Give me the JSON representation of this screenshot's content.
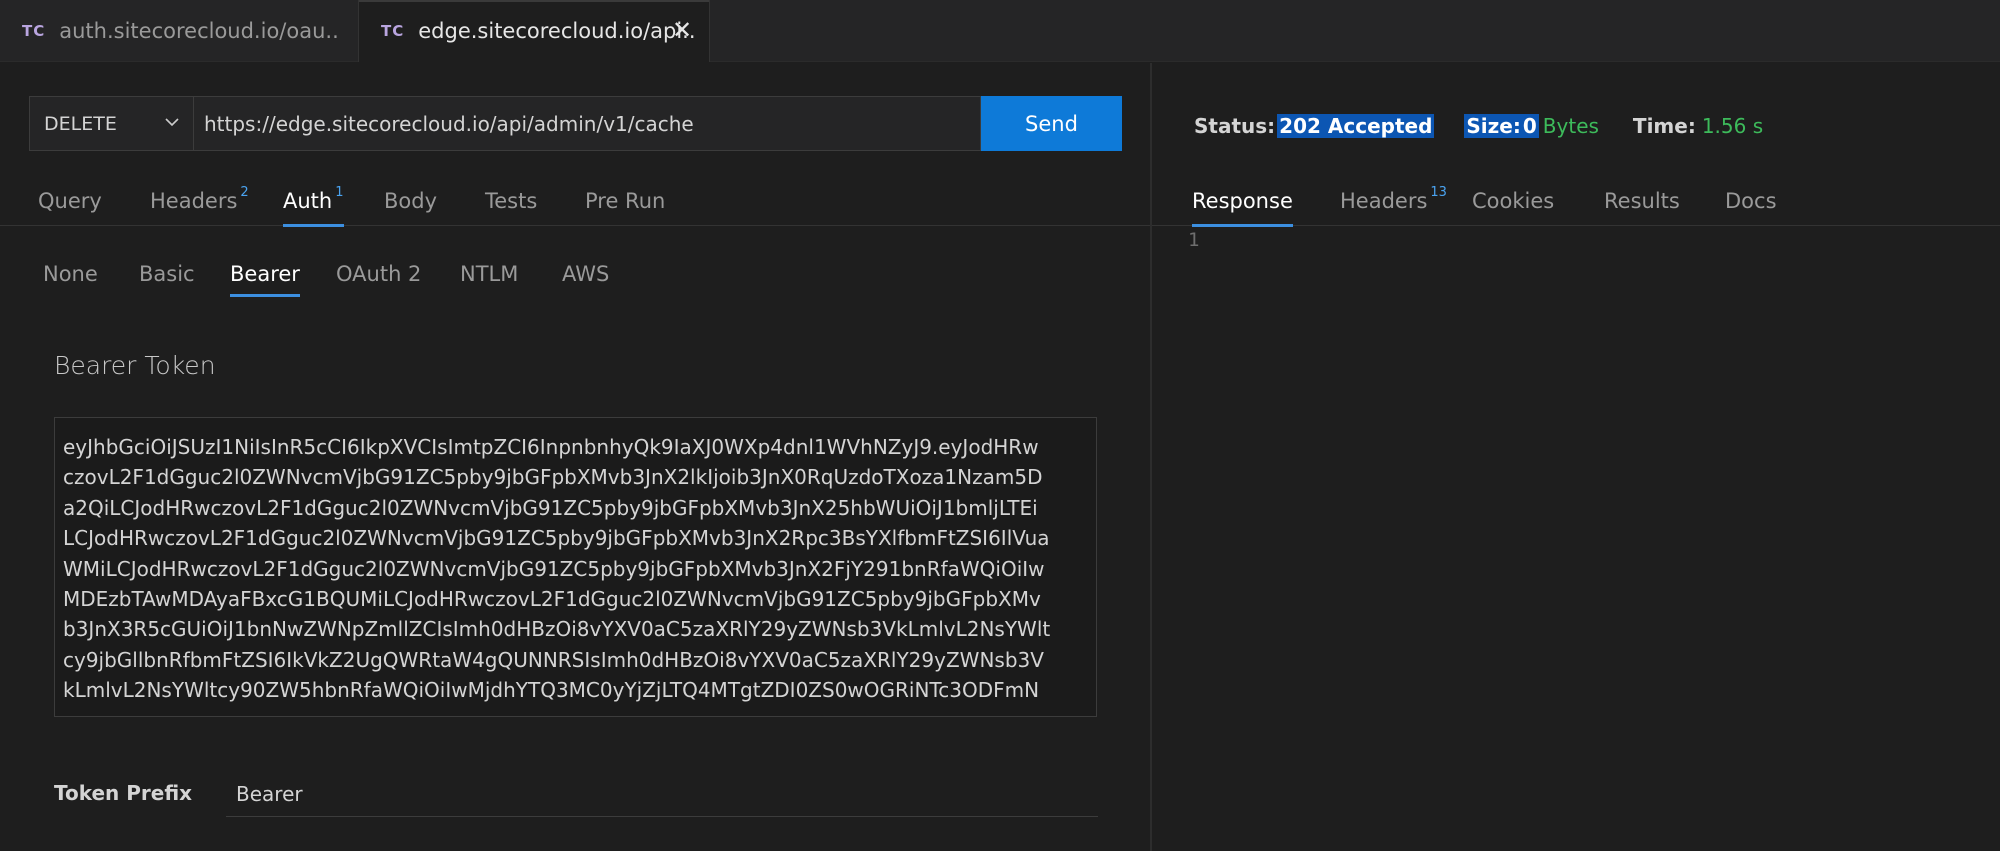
{
  "tabs": [
    {
      "icon": "TC",
      "label": "auth.sitecorecloud.io/oau.."
    },
    {
      "icon": "TC",
      "label": "edge.sitecorecloud.io/api..",
      "close": "✕"
    }
  ],
  "request": {
    "method": "DELETE",
    "url": "https://edge.sitecorecloud.io/api/admin/v1/cache",
    "send_label": "Send",
    "tabs": [
      {
        "label": "Query"
      },
      {
        "label": "Headers",
        "badge": "2"
      },
      {
        "label": "Auth",
        "badge": "1"
      },
      {
        "label": "Body"
      },
      {
        "label": "Tests"
      },
      {
        "label": "Pre Run"
      }
    ]
  },
  "auth": {
    "tabs": [
      "None",
      "Basic",
      "Bearer",
      "OAuth 2",
      "NTLM",
      "AWS"
    ],
    "bearer_label": "Bearer Token",
    "token_lines": [
      "eyJhbGciOiJSUzI1NiIsInR5cCI6IkpXVCIsImtpZCI6InpnbnhyQk9IaXJ0WXp4dnl1WVhNZyJ9.eyJodHRw",
      "czovL2F1dGguc2l0ZWNvcmVjbG91ZC5pby9jbGFpbXMvb3JnX2lkIjoib3JnX0RqUzdoTXoza1Nzam5D",
      "a2QiLCJodHRwczovL2F1dGguc2l0ZWNvcmVjbG91ZC5pby9jbGFpbXMvb3JnX25hbWUiOiJ1bmljLTEi",
      "LCJodHRwczovL2F1dGguc2l0ZWNvcmVjbG91ZC5pby9jbGFpbXMvb3JnX2Rpc3BsYXlfbmFtZSI6IlVua",
      "WMiLCJodHRwczovL2F1dGguc2l0ZWNvcmVjbG91ZC5pby9jbGFpbXMvb3JnX2FjY291bnRfaWQiOiIw",
      "MDEzbTAwMDAyaFBxcG1BQUMiLCJodHRwczovL2F1dGguc2l0ZWNvcmVjbG91ZC5pby9jbGFpbXMv",
      "b3JnX3R5cGUiOiJ1bnNwZWNpZmllZCIsImh0dHBzOi8vYXV0aC5zaXRlY29yZWNsb3VkLmlvL2NsYWlt",
      "cy9jbGllbnRfbmFtZSI6IkVkZ2UgQWRtaW4gQUNNRSIsImh0dHBzOi8vYXV0aC5zaXRlY29yZWNsb3V",
      "kLmlvL2NsYWltcy90ZW5hbnRfaWQiOiIwMjdhYTQ3MC0yYjZjLTQ4MTgtZDI0ZS0wOGRiNTc3ODFmN"
    ],
    "prefix_label": "Token Prefix",
    "prefix_value": "Bearer"
  },
  "response": {
    "status_label": "Status:",
    "status_value": "202 Accepted",
    "size_label": "Size:",
    "size_value": "0",
    "size_unit": "Bytes",
    "time_label": "Time:",
    "time_value": "1.56 s",
    "tabs": [
      {
        "label": "Response"
      },
      {
        "label": "Headers",
        "badge": "13"
      },
      {
        "label": "Cookies"
      },
      {
        "label": "Results"
      },
      {
        "label": "Docs"
      }
    ],
    "line_number": "1"
  },
  "colors": {
    "accent": "#0e7ad8",
    "tab_underline": "#3c8fe0",
    "success": "#3dbb5b",
    "selection": "#0c56b3"
  }
}
